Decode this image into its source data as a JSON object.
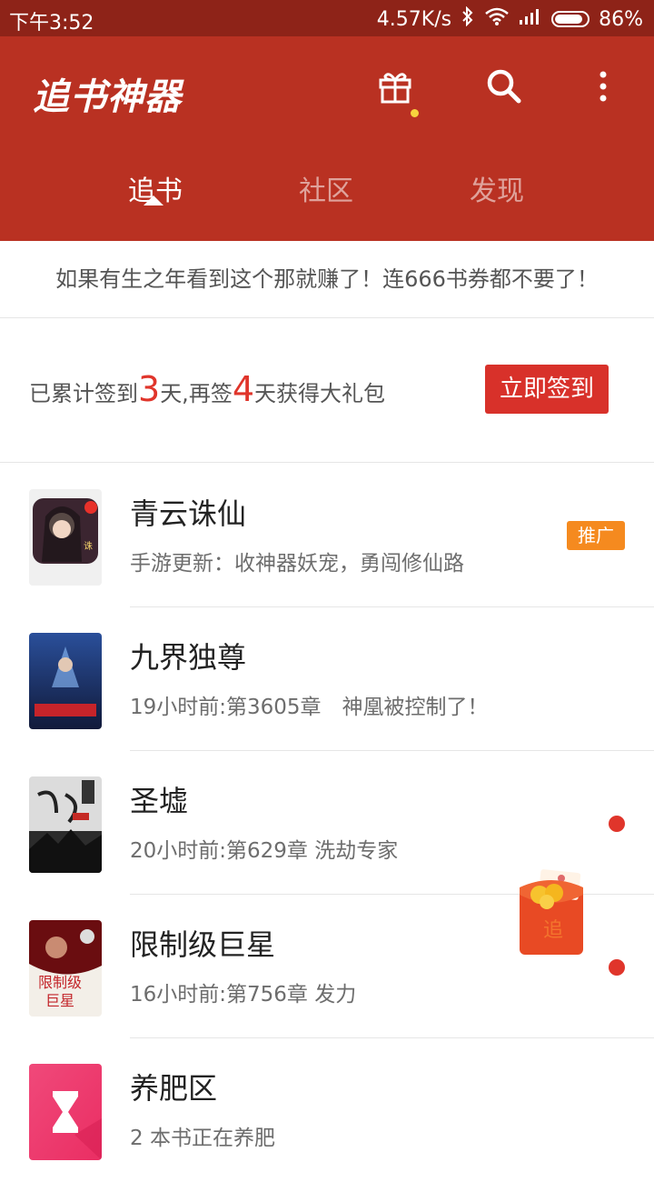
{
  "status_bar": {
    "time": "下午3:52",
    "net_speed": "4.57K/s",
    "battery": "86%"
  },
  "header": {
    "app_title": "追书神器",
    "tabs": [
      {
        "label": "追书"
      },
      {
        "label": "社区"
      },
      {
        "label": "发现"
      }
    ],
    "colors": {
      "primary": "#b93122",
      "status": "#8e2318"
    }
  },
  "notice": {
    "text": "如果有生之年看到这个那就赚了！连666书券都不要了！"
  },
  "signin": {
    "prefix": "已累计签到",
    "days_done": "3",
    "middle": "天,再签",
    "days_left": "4",
    "suffix": "天获得大礼包",
    "button": "立即签到"
  },
  "books": [
    {
      "title": "青云诛仙",
      "subtitle": "手游更新：收神器妖宠，勇闯修仙路",
      "badge": "推广",
      "has_dot": false
    },
    {
      "title": "九界独尊",
      "subtitle": "19小时前:第3605章　神凰被控制了！",
      "badge": "",
      "has_dot": false
    },
    {
      "title": "圣墟",
      "subtitle": "20小时前:第629章 洗劫专家",
      "badge": "",
      "has_dot": true
    },
    {
      "title": "限制级巨星",
      "subtitle": "16小时前:第756章 发力",
      "badge": "",
      "has_dot": true
    },
    {
      "title": "养肥区",
      "subtitle": "2 本书正在养肥",
      "badge": "",
      "has_dot": false
    }
  ]
}
